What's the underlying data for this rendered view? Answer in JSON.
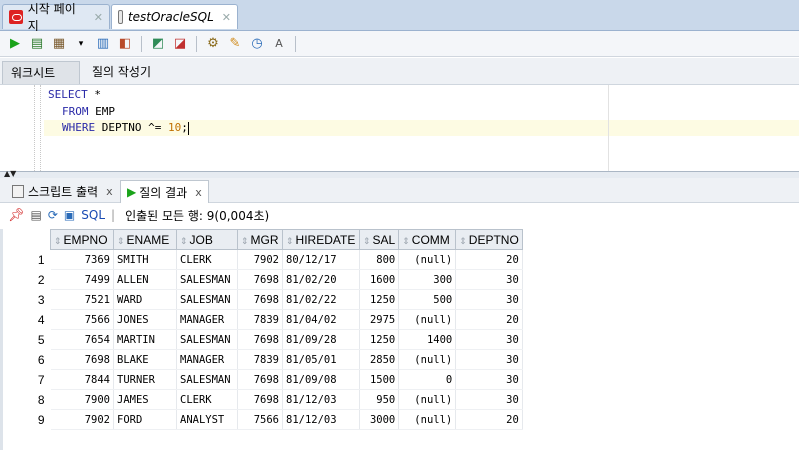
{
  "doc_tabs": [
    {
      "label": "시작 페이지",
      "icon": "oracle-icon"
    },
    {
      "label": "testOracleSQL",
      "icon": "database-icon"
    }
  ],
  "worksheet_tabs": {
    "worksheet": "워크시트",
    "query_builder": "질의 작성기"
  },
  "editor": {
    "line1_kw": "SELECT",
    "line1_rest": " *",
    "line2_kw": "FROM",
    "line2_rest": " EMP",
    "line3_kw": "WHERE",
    "line3_rest": " DEPTNO ^= ",
    "line3_num": "10",
    "line3_end": ";"
  },
  "result_tabs": {
    "script_output": "스크립트 출력",
    "query_result": "질의 결과",
    "close": "x"
  },
  "result_toolbar": {
    "sql_label": "SQL",
    "separator": "|",
    "status": "인출된 모든 행: 9(0,004초)"
  },
  "grid": {
    "columns": [
      "EMPNO",
      "ENAME",
      "JOB",
      "MGR",
      "HIREDATE",
      "SAL",
      "COMM",
      "DEPTNO"
    ],
    "rows": [
      [
        "1",
        "7369",
        "SMITH",
        "CLERK",
        "7902",
        "80/12/17",
        "800",
        "(null)",
        "20"
      ],
      [
        "2",
        "7499",
        "ALLEN",
        "SALESMAN",
        "7698",
        "81/02/20",
        "1600",
        "300",
        "30"
      ],
      [
        "3",
        "7521",
        "WARD",
        "SALESMAN",
        "7698",
        "81/02/22",
        "1250",
        "500",
        "30"
      ],
      [
        "4",
        "7566",
        "JONES",
        "MANAGER",
        "7839",
        "81/04/02",
        "2975",
        "(null)",
        "20"
      ],
      [
        "5",
        "7654",
        "MARTIN",
        "SALESMAN",
        "7698",
        "81/09/28",
        "1250",
        "1400",
        "30"
      ],
      [
        "6",
        "7698",
        "BLAKE",
        "MANAGER",
        "7839",
        "81/05/01",
        "2850",
        "(null)",
        "30"
      ],
      [
        "7",
        "7844",
        "TURNER",
        "SALESMAN",
        "7698",
        "81/09/08",
        "1500",
        "0",
        "30"
      ],
      [
        "8",
        "7900",
        "JAMES",
        "CLERK",
        "7698",
        "81/12/03",
        "950",
        "(null)",
        "30"
      ],
      [
        "9",
        "7902",
        "FORD",
        "ANALYST",
        "7566",
        "81/12/03",
        "3000",
        "(null)",
        "20"
      ]
    ]
  }
}
